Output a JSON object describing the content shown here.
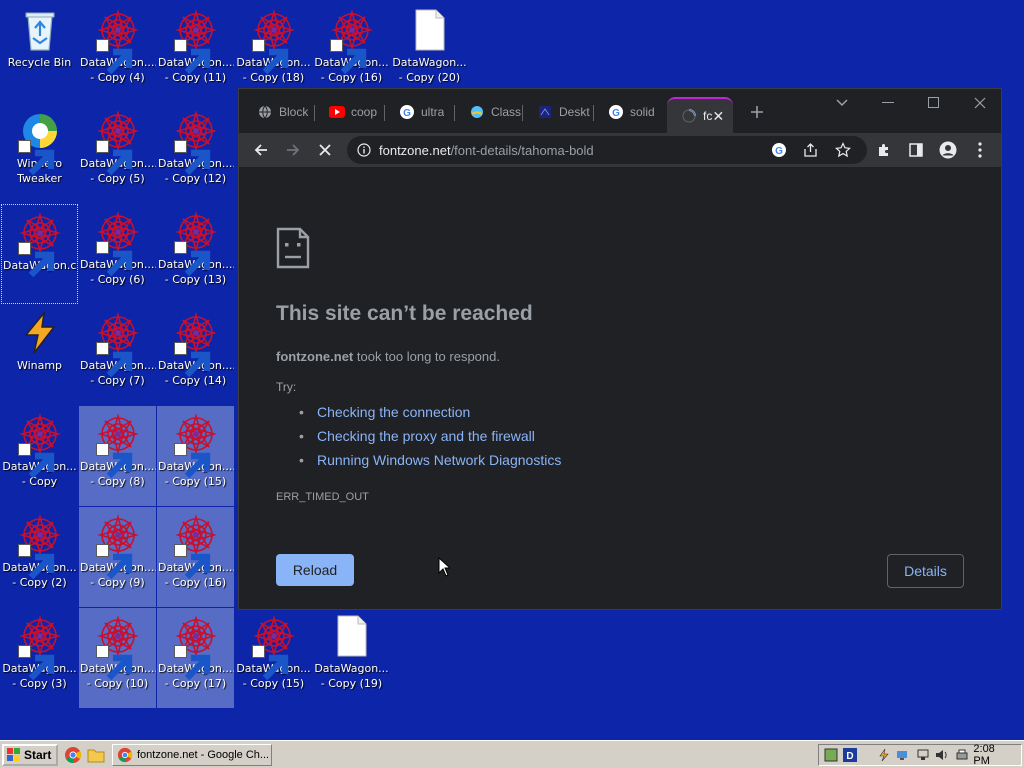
{
  "desktop": {
    "icons": [
      {
        "name": "recycle-bin",
        "label": "Recycle Bin",
        "kind": "recycle",
        "shortcut": false,
        "col": 0,
        "row": 0
      },
      {
        "name": "winaero-tweaker",
        "label": "Winaero Tweaker",
        "kind": "winaero",
        "shortcut": true,
        "col": 0,
        "row": 1
      },
      {
        "name": "datawagon-com",
        "label": "DataWagon.com",
        "kind": "datawagon",
        "shortcut": true,
        "col": 0,
        "row": 2,
        "focused": true
      },
      {
        "name": "winamp",
        "label": "Winamp",
        "kind": "winamp",
        "shortcut": false,
        "col": 0,
        "row": 3
      },
      {
        "name": "datawagon-copy",
        "label": "DataWagon... - Copy",
        "kind": "datawagon",
        "shortcut": true,
        "col": 0,
        "row": 4
      },
      {
        "name": "datawagon-copy-2",
        "label": "DataWagon... - Copy (2)",
        "kind": "datawagon",
        "shortcut": true,
        "col": 0,
        "row": 5
      },
      {
        "name": "datawagon-copy-3",
        "label": "DataWagon... - Copy (3)",
        "kind": "datawagon",
        "shortcut": true,
        "col": 0,
        "row": 6
      },
      {
        "name": "datawagon-copy-4",
        "label": "DataWagon.... - Copy (4)",
        "kind": "datawagon",
        "shortcut": true,
        "col": 1,
        "row": 0
      },
      {
        "name": "datawagon-copy-5",
        "label": "DataWagon.... - Copy (5)",
        "kind": "datawagon",
        "shortcut": true,
        "col": 1,
        "row": 1
      },
      {
        "name": "datawagon-copy-6",
        "label": "DataWagon.... - Copy (6)",
        "kind": "datawagon",
        "shortcut": true,
        "col": 1,
        "row": 2
      },
      {
        "name": "datawagon-copy-7",
        "label": "DataWagon.... - Copy (7)",
        "kind": "datawagon",
        "shortcut": true,
        "col": 1,
        "row": 3
      },
      {
        "name": "datawagon-copy-8",
        "label": "DataWagon.... - Copy (8)",
        "kind": "datawagon",
        "shortcut": true,
        "col": 1,
        "row": 4,
        "selected": true
      },
      {
        "name": "datawagon-copy-9",
        "label": "DataWagon.... - Copy (9)",
        "kind": "datawagon",
        "shortcut": true,
        "col": 1,
        "row": 5,
        "selected": true
      },
      {
        "name": "datawagon-copy-10",
        "label": "DataWagon.... - Copy (10)",
        "kind": "datawagon",
        "shortcut": true,
        "col": 1,
        "row": 6,
        "selected": true
      },
      {
        "name": "datawagon-copy-11",
        "label": "DataWagon.... - Copy (11)",
        "kind": "datawagon",
        "shortcut": true,
        "col": 2,
        "row": 0
      },
      {
        "name": "datawagon-copy-12",
        "label": "DataWagon.... - Copy (12)",
        "kind": "datawagon",
        "shortcut": true,
        "col": 2,
        "row": 1
      },
      {
        "name": "datawagon-copy-13",
        "label": "DataWagon.... - Copy (13)",
        "kind": "datawagon",
        "shortcut": true,
        "col": 2,
        "row": 2
      },
      {
        "name": "datawagon-copy-14",
        "label": "DataWagon.... - Copy (14)",
        "kind": "datawagon",
        "shortcut": true,
        "col": 2,
        "row": 3
      },
      {
        "name": "datawagon-copy-15",
        "label": "DataWagon.... - Copy (15)",
        "kind": "datawagon",
        "shortcut": true,
        "col": 2,
        "row": 4,
        "selected": true
      },
      {
        "name": "datawagon-copy-16",
        "label": "DataWagon.... - Copy (16)",
        "kind": "datawagon",
        "shortcut": true,
        "col": 2,
        "row": 5,
        "selected": true
      },
      {
        "name": "datawagon-copy-17",
        "label": "DataWagon.... - Copy (17)",
        "kind": "datawagon",
        "shortcut": true,
        "col": 2,
        "row": 6,
        "selected": true
      },
      {
        "name": "datawagon-copy-18",
        "label": "DataWagon... - Copy (18)",
        "kind": "datawagon",
        "shortcut": true,
        "col": 3,
        "row": 0
      },
      {
        "name": "datawagon-copy-15-b",
        "label": "DataWagon... - Copy (15) ...",
        "kind": "datawagon",
        "shortcut": true,
        "col": 3,
        "row": 6
      },
      {
        "name": "datawagon-copy-16-b",
        "label": "DataWagon... - Copy (16) ...",
        "kind": "datawagon",
        "shortcut": true,
        "col": 4,
        "row": 0
      },
      {
        "name": "datawagon-copy-19",
        "label": "DataWagon... - Copy (19) ...",
        "kind": "file",
        "shortcut": false,
        "col": 4,
        "row": 6
      },
      {
        "name": "datawagon-copy-20",
        "label": "DataWagon... - Copy (20) ...",
        "kind": "file",
        "shortcut": false,
        "col": 5,
        "row": 0
      }
    ]
  },
  "browser": {
    "tabs": [
      {
        "title": "Block",
        "icon": "globe-icon"
      },
      {
        "title": "coop",
        "icon": "youtube-icon"
      },
      {
        "title": "ultra",
        "icon": "google-icon"
      },
      {
        "title": "Class",
        "icon": "class-icon"
      },
      {
        "title": "Deskt",
        "icon": "desktop-icon"
      },
      {
        "title": "solid",
        "icon": "google-icon"
      },
      {
        "title": "fc",
        "icon": "loading-spinner-icon",
        "active": true
      }
    ],
    "url": {
      "host": "fontzone.net",
      "path": "/font-details/tahoma-bold"
    },
    "error": {
      "title": "This site can’t be reached",
      "host": "fontzone.net",
      "desc": " took too long to respond.",
      "try": "Try:",
      "suggestions": [
        "Checking the connection",
        "Checking the proxy and the firewall",
        "Running Windows Network Diagnostics"
      ],
      "code": "ERR_TIMED_OUT",
      "reload": "Reload",
      "details": "Details"
    }
  },
  "taskbar": {
    "start": "Start",
    "task": "fontzone.net - Google Ch...",
    "clock": "2:08 PM"
  },
  "colors": {
    "desktop": "#0d25a8",
    "chrome_dark": "#202124",
    "link": "#8ab4f8",
    "active_tab_accent": "#c026d3"
  }
}
